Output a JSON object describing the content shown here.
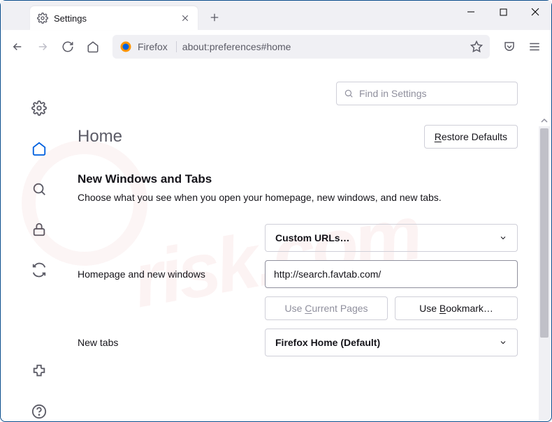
{
  "tab": {
    "title": "Settings"
  },
  "url": {
    "context": "Firefox",
    "address": "about:preferences#home"
  },
  "search": {
    "placeholder": "Find in Settings"
  },
  "page": {
    "heading": "Home",
    "restore_label": "Restore Defaults",
    "restore_u": "R",
    "section_title": "New Windows and Tabs",
    "section_desc": "Choose what you see when you open your homepage, new windows, and new tabs.",
    "homepage_select": "Custom URLs…",
    "homepage_label": "Homepage and new windows",
    "homepage_value": "http://search.favtab.com/",
    "use_current": "Use Current Pages",
    "use_current_u": "C",
    "use_bookmark": "Use Bookmark…",
    "use_bookmark_u": "B",
    "newtabs_label": "New tabs",
    "newtabs_select": "Firefox Home (Default)"
  }
}
